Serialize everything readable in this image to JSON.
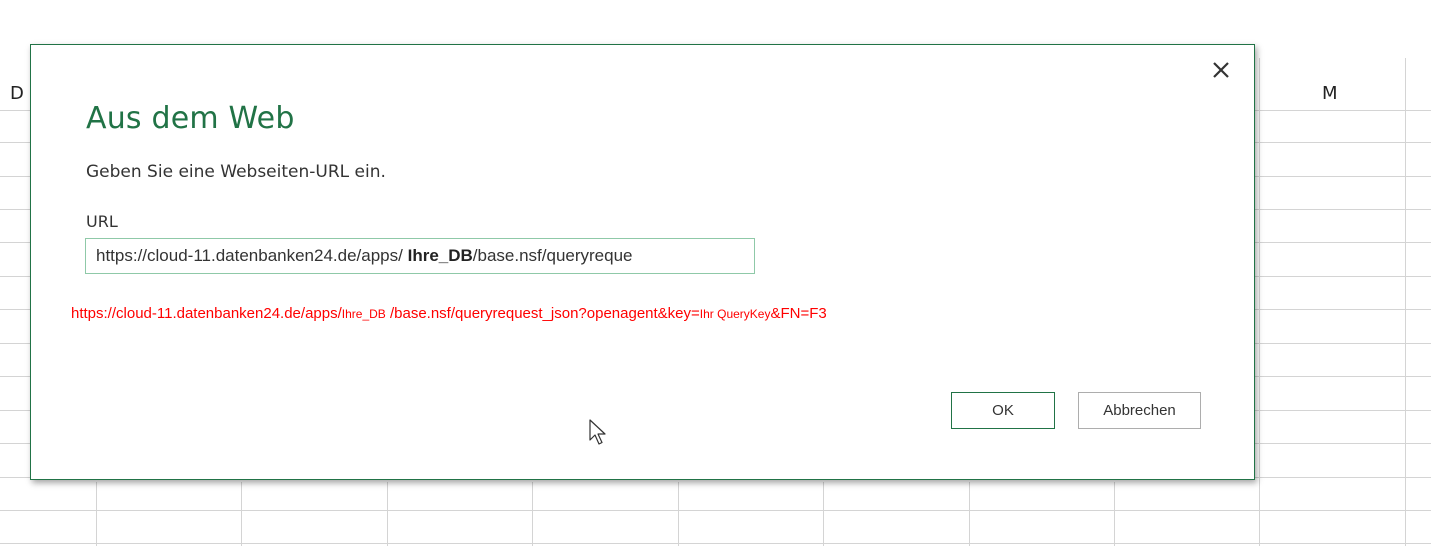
{
  "spreadsheet": {
    "column_left_label": "D",
    "column_right_label": "M"
  },
  "dialog": {
    "title": "Aus dem Web",
    "instruction": "Geben Sie eine Webseiten-URL ein.",
    "url_label": "URL",
    "url_value_part1": "https://cloud-11.datenbanken24.de/apps/ ",
    "url_value_bold": "Ihre_DB",
    "url_value_part2": "/base.nsf/queryreque",
    "close_icon": "close-icon",
    "ok_label": "OK",
    "cancel_label": "Abbrechen",
    "accent_color": "#217346"
  },
  "annotation": {
    "part1": "https://cloud-11.datenbanken24.de/apps/",
    "part2": "Ihre_DB",
    "part3": " /base.nsf/queryrequest_json?openagent&key=",
    "part4": "Ihr QueryKey",
    "part5": "&FN=F3",
    "color": "#ff0000"
  }
}
